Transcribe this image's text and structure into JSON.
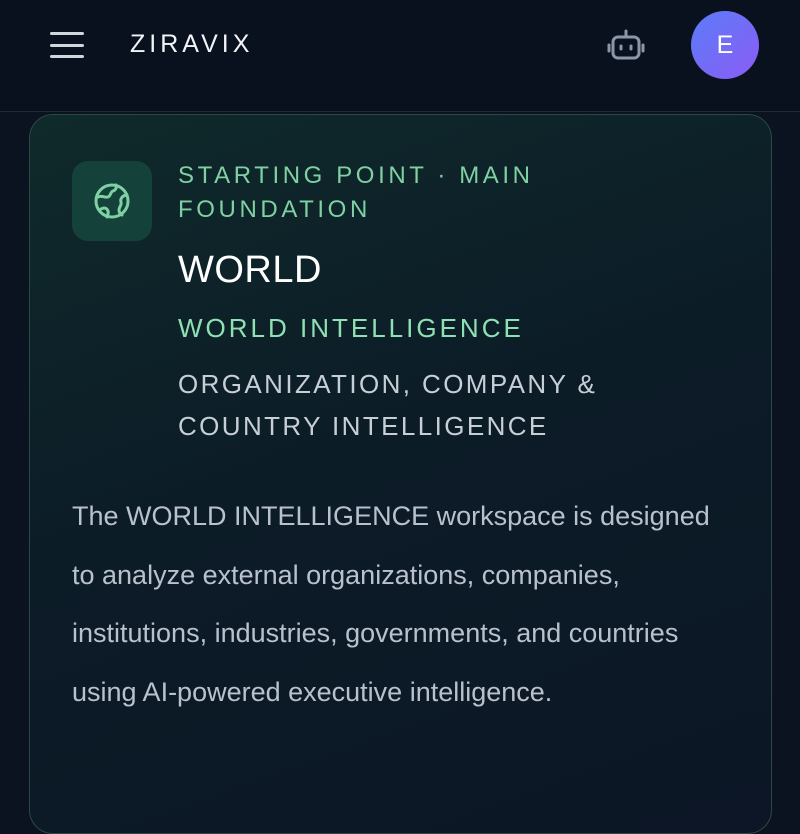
{
  "header": {
    "brand": "ZIRAVIX",
    "avatar_initial": "E",
    "icons": {
      "menu": "hamburger-menu-icon",
      "assistant": "robot-icon"
    }
  },
  "workspace_card": {
    "icon": "globe-icon",
    "eyebrow": "STARTING POINT · MAIN FOUNDATION",
    "title": "WORLD",
    "subtitle": "WORLD INTELLIGENCE",
    "tagline": "ORGANIZATION, COMPANY & COUNTRY INTELLIGENCE",
    "description": "The WORLD INTELLIGENCE workspace is designed to analyze external organizations, companies, institutions, industries, governments, and countries using AI-powered executive intelligence."
  },
  "colors": {
    "accent_green": "#7fd1a4",
    "avatar_gradient_start": "#5b7cf7",
    "avatar_gradient_end": "#8b5cf6",
    "background": "#0b1220"
  }
}
